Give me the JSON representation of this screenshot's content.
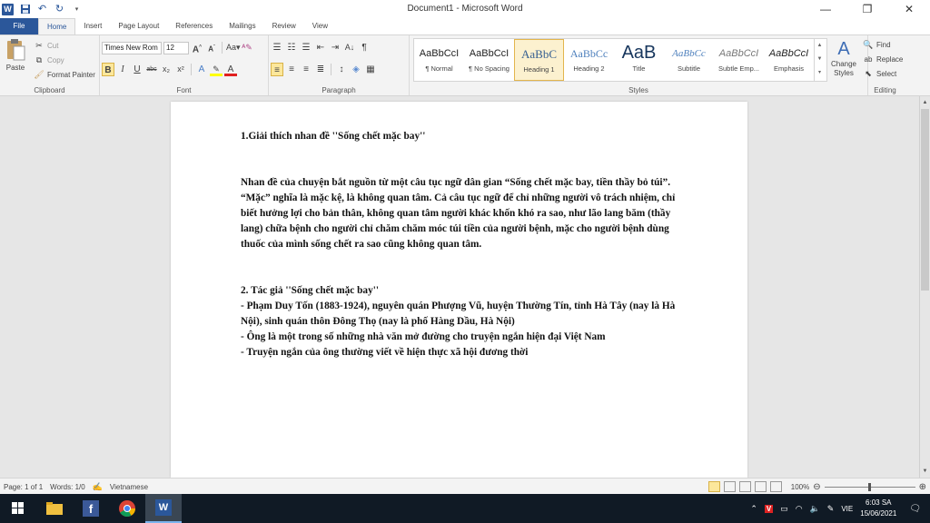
{
  "window": {
    "title": "Document1 - Microsoft Word",
    "minimize": "—",
    "restore": "❐",
    "close": "✕"
  },
  "tabs": [
    "File",
    "Home",
    "Insert",
    "Page Layout",
    "References",
    "Mailings",
    "Review",
    "View"
  ],
  "ribbon": {
    "clipboard": {
      "label": "Clipboard",
      "paste": "Paste",
      "cut": "Cut",
      "copy": "Copy",
      "format_painter": "Format Painter"
    },
    "font": {
      "label": "Font",
      "family": "Times New Rom",
      "size": "12"
    },
    "paragraph": {
      "label": "Paragraph"
    },
    "styles": {
      "label": "Styles",
      "items": [
        {
          "sample": "AaBbCcI",
          "name": "¶ Normal"
        },
        {
          "sample": "AaBbCcI",
          "name": "¶ No Spacing"
        },
        {
          "sample": "AaBbC",
          "name": "Heading 1"
        },
        {
          "sample": "AaBbCc",
          "name": "Heading 2"
        },
        {
          "sample": "AaB",
          "name": "Title"
        },
        {
          "sample": "AaBbCc",
          "name": "Subtitle"
        },
        {
          "sample": "AaBbCcI",
          "name": "Subtle Emp..."
        },
        {
          "sample": "AaBbCcI",
          "name": "Emphasis"
        }
      ],
      "change_styles": "Change Styles"
    },
    "editing": {
      "label": "Editing",
      "find": "Find",
      "replace": "Replace",
      "select": "Select"
    }
  },
  "document": {
    "heading1": "1.Giải thích nhan đề ''Sống chết mặc bay''",
    "para1": "Nhan đề của chuyện bắt nguồn từ một câu tục ngữ dân gian “Sống chết mặc bay, tiền thầy bỏ túi”. “Mặc” nghĩa là mặc kệ, là không quan tâm. Cả câu tục ngữ để chỉ những người vô trách nhiệm, chỉ biết hưởng lợi cho bản thân, không quan tâm người khác khốn khó ra sao, như lão lang băm (thầy lang) chữa bệnh cho người chỉ chăm chăm móc túi tiền của người bệnh, mặc cho người bệnh dùng thuốc của mình sống chết ra sao cũng không quan tâm.",
    "heading2": "2. Tác giả ''Sống chết mặc bay''",
    "line1": " - Phạm Duy Tốn (1883-1924), nguyên quán Phượng Vũ, huyện Thường Tín, tỉnh Hà Tây (nay là Hà Nội), sinh quán thôn Đông Thọ (nay là phố Hàng Dầu, Hà Nội)",
    "line2": "- Ông là một trong số những nhà văn mở đường cho truyện ngắn hiện đại Việt Nam",
    "line3": "- Truyện ngắn của ông thường viết về hiện thực xã hội đương thời"
  },
  "status": {
    "page": "Page: 1 of 1",
    "words": "Words: 1/0",
    "language": "Vietnamese",
    "zoom": "100%",
    "zoom_percent": 100
  },
  "taskbar": {
    "time": "6:03 SA",
    "date": "15/06/2021",
    "lang": "VIE"
  },
  "colors": {
    "accent": "#2b579a",
    "taskbar": "#101a25"
  }
}
